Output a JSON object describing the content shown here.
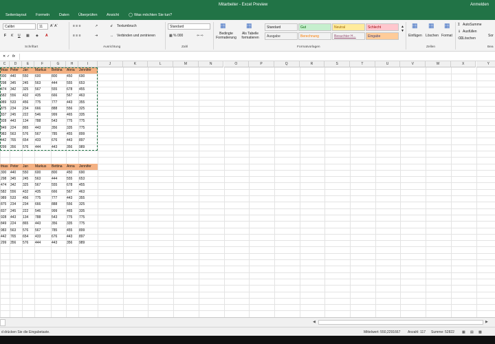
{
  "window": {
    "title": "Mitarbeiter - Excel Preview",
    "signin": "Anmelden"
  },
  "menu": {
    "items": [
      "Seitenlayout",
      "Formeln",
      "Daten",
      "Überprüfen",
      "Ansicht"
    ],
    "tell_me": "Was möchten Sie tun?"
  },
  "ribbon": {
    "font_name": "Calibri",
    "font_size": "11",
    "wrap_text": "Textumbruch",
    "merge_center": "Verbinden und zentrieren",
    "number_format": "Standard",
    "cond_format": "Bedingte Formatierung",
    "as_table": "Als Tabelle formatieren",
    "styles": [
      {
        "label": "Standard",
        "bg": "#ffffff",
        "fg": "#000000"
      },
      {
        "label": "Gut",
        "bg": "#c6efce",
        "fg": "#006100"
      },
      {
        "label": "Neutral",
        "bg": "#ffeb9c",
        "fg": "#9c6500"
      },
      {
        "label": "Schlecht",
        "bg": "#ffc7ce",
        "fg": "#9c0006"
      },
      {
        "label": "Ausgabe",
        "bg": "#f2f2f2",
        "fg": "#3f3f3f"
      },
      {
        "label": "Berechnung",
        "bg": "#f2f2f2",
        "fg": "#fa7d00"
      },
      {
        "label": "Besuchter H...",
        "bg": "#ffffff",
        "fg": "#954f72"
      },
      {
        "label": "Eingabe",
        "bg": "#ffcc99",
        "fg": "#3f3f76"
      }
    ],
    "insert": "Einfügen",
    "delete": "Löschen",
    "format": "Format",
    "autosum": "AutoSumme",
    "fill": "Ausfüllen",
    "clear": "Löschen",
    "sort": "Sor",
    "groups": [
      "Schriftart",
      "Ausrichtung",
      "Zahl",
      "Formatvorlagen",
      "Zellen",
      "Bea"
    ]
  },
  "formula": {
    "fx": "fx"
  },
  "grid": {
    "columns": [
      "C",
      "D",
      "E",
      "F",
      "G",
      "H",
      "I",
      "J",
      "K",
      "L",
      "M",
      "N",
      "O",
      "P",
      "Q",
      "R",
      "S",
      "T",
      "U",
      "V",
      "W",
      "X",
      "Y"
    ],
    "header": [
      "thias",
      "Peter",
      "Jan",
      "Markus",
      "Bettina",
      "Anna",
      "Jennifer"
    ],
    "rows1": [
      [
        "300",
        "440",
        "550",
        "600",
        "800",
        "450",
        "690"
      ],
      [
        "298",
        "345",
        "245",
        "563",
        "444",
        "555",
        "653"
      ],
      [
        "474",
        "342",
        "325",
        "567",
        "555",
        "678",
        "455"
      ],
      [
        "582",
        "556",
        "432",
        "435",
        "666",
        "567",
        "463"
      ],
      [
        "989",
        "533",
        "456",
        "775",
        "777",
        "443",
        "355"
      ],
      [
        "875",
        "234",
        "234",
        "666",
        "888",
        "556",
        "325"
      ],
      [
        "837",
        "245",
        "222",
        "546",
        "999",
        "465",
        "335"
      ],
      [
        "928",
        "443",
        "134",
        "788",
        "543",
        "775",
        "775"
      ],
      [
        "849",
        "224",
        "865",
        "443",
        "356",
        "335",
        "775"
      ],
      [
        "983",
        "563",
        "576",
        "567",
        "785",
        "455",
        "899"
      ],
      [
        "442",
        "765",
        "654",
        "433",
        "676",
        "443",
        "897"
      ],
      [
        "299",
        "356",
        "576",
        "444",
        "443",
        "356",
        "989"
      ]
    ],
    "rows2": [
      [
        "300",
        "440",
        "550",
        "600",
        "800",
        "450",
        "690"
      ],
      [
        "298",
        "345",
        "245",
        "563",
        "444",
        "555",
        "653"
      ],
      [
        "474",
        "342",
        "325",
        "567",
        "555",
        "678",
        "455"
      ],
      [
        "582",
        "556",
        "432",
        "435",
        "666",
        "567",
        "463"
      ],
      [
        "989",
        "533",
        "456",
        "775",
        "777",
        "443",
        "355"
      ],
      [
        "875",
        "234",
        "234",
        "666",
        "888",
        "556",
        "325"
      ],
      [
        "837",
        "245",
        "222",
        "546",
        "999",
        "465",
        "335"
      ],
      [
        "928",
        "443",
        "134",
        "788",
        "543",
        "775",
        "775"
      ],
      [
        "849",
        "224",
        "865",
        "443",
        "356",
        "335",
        "775"
      ],
      [
        "983",
        "563",
        "576",
        "567",
        "785",
        "455",
        "899"
      ],
      [
        "442",
        "765",
        "654",
        "433",
        "676",
        "443",
        "897"
      ],
      [
        "299",
        "356",
        "576",
        "444",
        "443",
        "356",
        "989"
      ]
    ]
  },
  "status": {
    "message": "d drücken Sie die Eingabetaste.",
    "average": "Mittelwert: 550,2291667",
    "count": "Anzahl: 117",
    "sum": "Summe: 52822"
  },
  "colors": {
    "excel_green": "#217346",
    "header_fill": "#f4b183"
  }
}
